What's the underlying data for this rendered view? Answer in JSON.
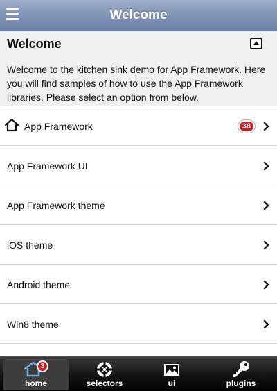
{
  "header": {
    "title": "Welcome",
    "menu_icon": "hamburger-menu-icon"
  },
  "intro": {
    "title": "Welcome",
    "text": "Welcome to the kitchen sink demo for App Framework. Here you will find samples of how to use the App Framework libraries. Please select an option from below.",
    "collapse_icon": "collapse-up-icon"
  },
  "list": {
    "items": [
      {
        "label": "App Framework",
        "icon": "home-icon",
        "badge": "38"
      },
      {
        "label": "App Framework UI"
      },
      {
        "label": "App Framework theme"
      },
      {
        "label": "iOS theme"
      },
      {
        "label": "Android theme"
      },
      {
        "label": "Win8 theme"
      }
    ]
  },
  "tabbar": {
    "tabs": [
      {
        "label": "home",
        "icon": "home-icon",
        "badge": "3",
        "active": true
      },
      {
        "label": "selectors",
        "icon": "crosshair-icon"
      },
      {
        "label": "ui",
        "icon": "picture-icon"
      },
      {
        "label": "plugins",
        "icon": "key-icon"
      }
    ]
  },
  "colors": {
    "header_gradient_top": "#9fb0cc",
    "header_gradient_bottom": "#6c82a8",
    "badge": "#cc1a22",
    "tabbar": "#161616",
    "intro_bg": "#f0f0f0"
  }
}
